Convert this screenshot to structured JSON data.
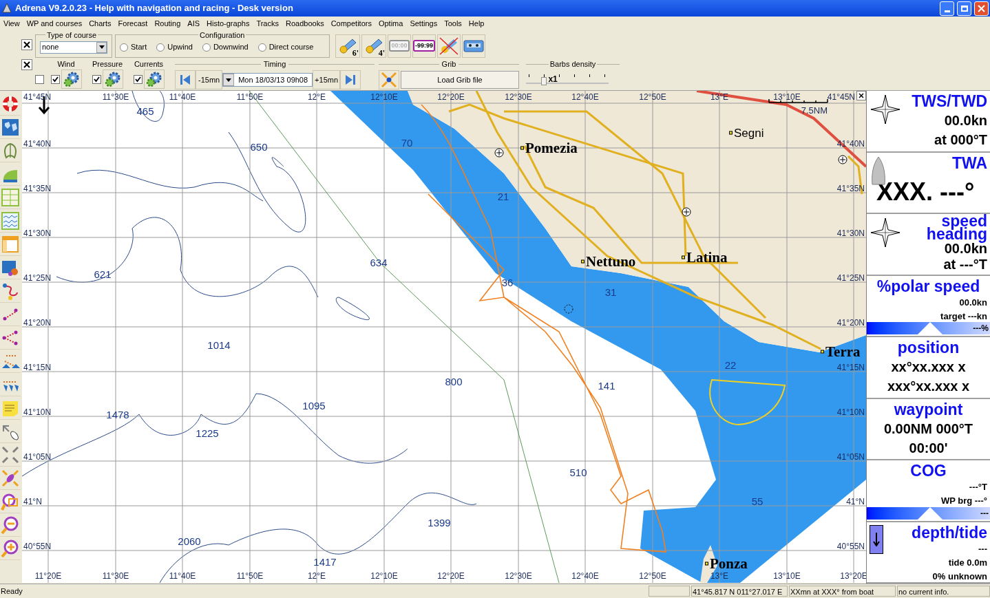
{
  "window": {
    "title": "Adrena V9.2.0.23 - Help with navigation and racing - Desk version"
  },
  "menu": [
    "View",
    "WP and courses",
    "Charts",
    "Forecast",
    "Routing",
    "AIS",
    "Histo-graphs",
    "Tracks",
    "Roadbooks",
    "Competitors",
    "Optima",
    "Settings",
    "Tools",
    "Help"
  ],
  "course_bar": {
    "type_label": "Type of course",
    "type_value": "none",
    "config_label": "Configuration",
    "radios": [
      {
        "label": "Start",
        "selected": false
      },
      {
        "label": "Upwind",
        "selected": false
      },
      {
        "label": "Downwind",
        "selected": false
      },
      {
        "label": "Direct course",
        "selected": false
      }
    ],
    "tools": [
      {
        "kind": "boat",
        "label": "6'"
      },
      {
        "kind": "boat",
        "label": "4'"
      },
      {
        "kind": "timer",
        "label": "00:00"
      },
      {
        "kind": "countdown",
        "label": "-99:99"
      },
      {
        "kind": "cancel"
      },
      {
        "kind": "tape"
      }
    ]
  },
  "layer_bar": {
    "all_checked": false,
    "layers": [
      {
        "label": "Wind",
        "checked": true
      },
      {
        "label": "Pressure",
        "checked": true
      },
      {
        "label": "Currents",
        "checked": true
      }
    ],
    "timing": {
      "label": "Timing",
      "back": "-15mn",
      "date": "Mon 18/03/13 09h08",
      "forward": "+15mn"
    },
    "grib": {
      "label": "Grib",
      "button": "Load Grib file"
    },
    "barbs": {
      "label": "Barbs density",
      "value": "x1",
      "level": 0.2
    }
  },
  "map": {
    "top_labels": [
      "11°30E",
      "11°40E",
      "11°50E",
      "12°E",
      "12°10E",
      "12°20E",
      "12°30E",
      "12°40E",
      "12°50E",
      "13°E",
      "13°10E"
    ],
    "bottom_labels": [
      "11°20E",
      "11°30E",
      "11°40E",
      "11°50E",
      "12°E",
      "12°10E",
      "12°20E",
      "12°30E",
      "12°40E",
      "12°50E",
      "13°E",
      "13°10E",
      "13°20E"
    ],
    "left_labels": [
      "41°45N",
      "41°40N",
      "41°35N",
      "41°30N",
      "41°25N",
      "41°20N",
      "41°15N",
      "41°10N",
      "41°05N",
      "41°N",
      "40°55N"
    ],
    "right_labels": [
      "41°45N",
      "41°40N",
      "41°35N",
      "41°30N",
      "41°25N",
      "41°20N",
      "41°15N",
      "41°10N",
      "41°05N",
      "41°N",
      "40°55N"
    ],
    "scale": "7.5NM",
    "places": [
      {
        "name": "Pomezia",
        "kind": "town"
      },
      {
        "name": "Segni",
        "kind": "village"
      },
      {
        "name": "Nettuno",
        "kind": "town"
      },
      {
        "name": "Latina",
        "kind": "town"
      },
      {
        "name": "Terra",
        "kind": "town"
      },
      {
        "name": "Ponza",
        "kind": "town"
      }
    ],
    "depths": [
      "465",
      "650",
      "70",
      "21",
      "634",
      "621",
      "36",
      "31",
      "1014",
      "22",
      "800",
      "141",
      "1095",
      "1478",
      "1225",
      "510",
      "55",
      "1399",
      "2060",
      "1417"
    ]
  },
  "instruments": [
    {
      "kind": "compass",
      "titles": [
        "TWS/TWD"
      ],
      "lines": [
        "00.0kn",
        "at 000°T"
      ]
    },
    {
      "kind": "boat",
      "titles": [
        "TWA"
      ],
      "lines": [
        "XXX. ---°"
      ]
    },
    {
      "kind": "compass",
      "titles": [
        "speed",
        "heading"
      ],
      "lines": [
        "00.0kn",
        "at ---°T"
      ]
    },
    {
      "kind": "none",
      "titles": [
        "%polar speed"
      ],
      "lines": [
        "00.0kn",
        "target ---kn"
      ],
      "bar": "---%"
    },
    {
      "kind": "none",
      "titles": [
        "position"
      ],
      "lines": [
        "xx°xx.xxx x",
        "xxx°xx.xxx x"
      ]
    },
    {
      "kind": "none",
      "titles": [
        "waypoint"
      ],
      "lines": [
        "0.00NM 000°T",
        "00:00'"
      ]
    },
    {
      "kind": "none",
      "titles": [
        "COG"
      ],
      "lines": [
        "---°T",
        "WP brg ---°"
      ],
      "bar": "---"
    },
    {
      "kind": "arrow",
      "titles": [
        "depth/tide"
      ],
      "lines": [
        "---",
        "tide 0.0m",
        "0% unknown"
      ]
    }
  ],
  "status_bar": {
    "message": "Ready",
    "fields": [
      "41°45.817 N  011°27.017 E",
      "XXmn at XXX° from boat",
      "no current info."
    ]
  }
}
